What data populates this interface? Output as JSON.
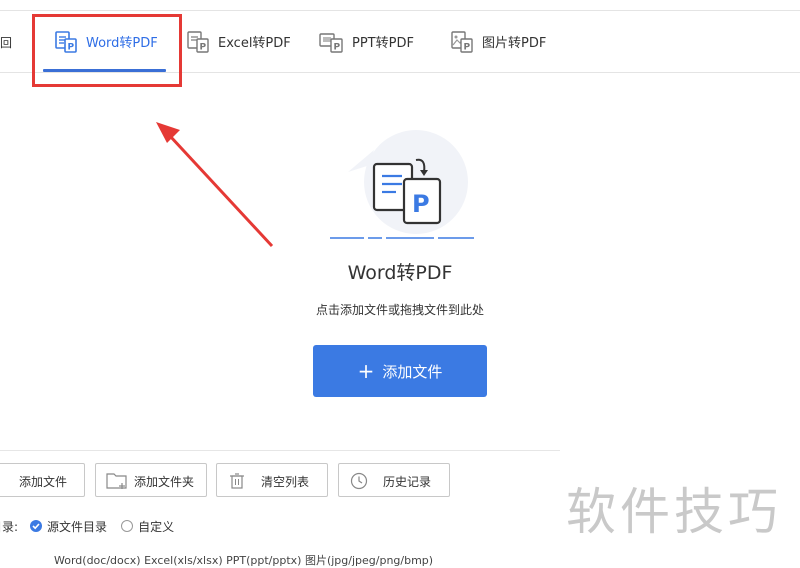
{
  "header": {
    "back_label": "返回",
    "tabs": [
      {
        "label": "Word转PDF",
        "active": true
      },
      {
        "label": "Excel转PDF",
        "active": false
      },
      {
        "label": "PPT转PDF",
        "active": false
      },
      {
        "label": "图片转PDF",
        "active": false
      }
    ]
  },
  "main": {
    "title": "Word转PDF",
    "subtitle": "点击添加文件或拖拽文件到此处",
    "add_button": {
      "icon": "+",
      "label": "添加文件"
    }
  },
  "toolbar": {
    "add_file": "添加文件",
    "add_folder": "添加文件夹",
    "clear_list": "清空列表",
    "history": "历史记录"
  },
  "output": {
    "label": "目录:",
    "option_source": "源文件目录",
    "option_custom": "自定义",
    "selected": "源文件目录"
  },
  "formats_text": "Word(doc/docx)   Excel(xls/xlsx)   PPT(ppt/pptx)   图片(jpg/jpeg/png/bmp)",
  "watermark": "软件技巧",
  "colors": {
    "accent": "#3b7ae3",
    "annotation": "#e53935"
  }
}
